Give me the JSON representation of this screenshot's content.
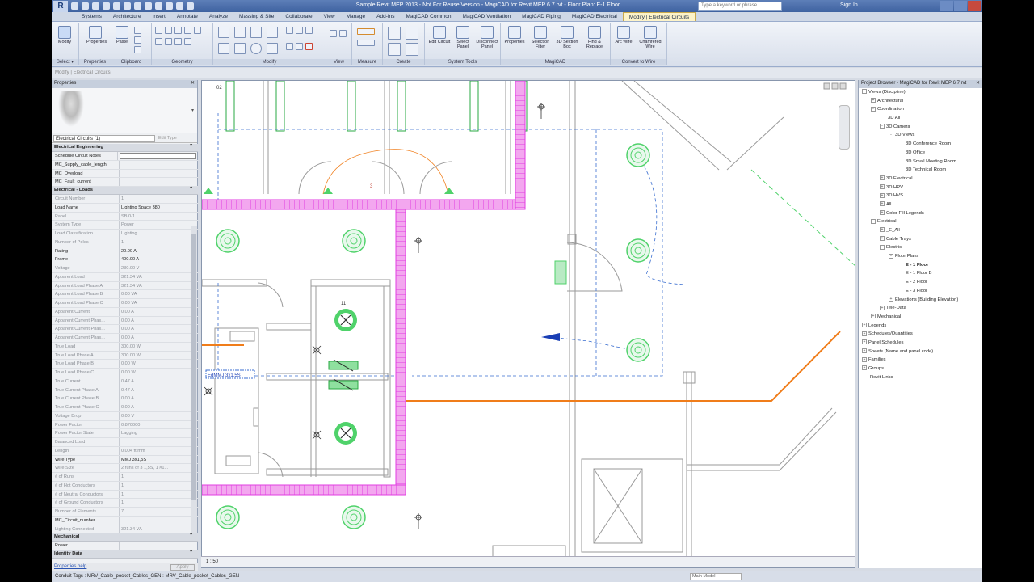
{
  "titlebar": {
    "title": "Sample Revit MEP 2013 - Not For Reuse Version - MagiCAD for Revit MEP 6.7.rvt - Floor Plan: E-1 Floor",
    "search_placeholder": "Type a keyword or phrase",
    "signin": "Sign In"
  },
  "tabs": [
    "Systems",
    "Architecture",
    "Insert",
    "Annotate",
    "Analyze",
    "Massing & Site",
    "Collaborate",
    "View",
    "Manage",
    "Add-Ins",
    "MagiCAD Common",
    "MagiCAD Ventilation",
    "MagiCAD Piping",
    "MagiCAD Electrical",
    "Modify | Electrical Circuits"
  ],
  "active_tab": "Modify | Electrical Circuits",
  "ribbon": {
    "groups": [
      "Select",
      "Properties",
      "Clipboard",
      "Geometry",
      "Modify",
      "View",
      "Measure",
      "Create",
      "System Tools",
      "MagiCAD",
      "Convert to Wire"
    ],
    "buttons": {
      "modify": "Modify",
      "properties": "Properties",
      "paste": "Paste",
      "cut": "Cut",
      "edit_circuit": "Edit Circuit",
      "select_panel": "Select Panel",
      "disconnect_panel": "Disconnect Panel",
      "mc_properties": "Properties",
      "selection_filter": "Selection Filter",
      "section_box": "3D Section Box",
      "find_replace": "Find & Replace",
      "arc_wire": "Arc Wire",
      "chamfered_wire": "Chamfered Wire"
    },
    "select_dd": "Select ▾"
  },
  "optionsbar": "Modify | Electrical Circuits",
  "properties": {
    "header": "Properties",
    "type_selector": "Electrical Circuits (1)",
    "edit_type": "Edit Type",
    "sections": [
      {
        "title": "Electrical Engineering",
        "rows": [
          {
            "k": "Schedule Circuit Notes",
            "v": "",
            "dim": false,
            "input": true
          },
          {
            "k": "MC_Supply_cable_length",
            "v": "",
            "dim": false
          },
          {
            "k": "MC_Overload",
            "v": "",
            "dim": false
          },
          {
            "k": "MC_Fault_current",
            "v": "",
            "dim": false
          }
        ]
      },
      {
        "title": "Electrical - Loads",
        "rows": [
          {
            "k": "Circuit Number",
            "v": "1",
            "dim": true
          },
          {
            "k": "Load Name",
            "v": "Lighting Space 380",
            "dim": false
          },
          {
            "k": "Panel",
            "v": "SB 0-1",
            "dim": true
          },
          {
            "k": "System Type",
            "v": "Power",
            "dim": true
          },
          {
            "k": "Load Classification",
            "v": "Lighting",
            "dim": true
          },
          {
            "k": "Number of Poles",
            "v": "1",
            "dim": true
          },
          {
            "k": "Rating",
            "v": "20.00 A",
            "dim": false
          },
          {
            "k": "Frame",
            "v": "400.00 A",
            "dim": false
          },
          {
            "k": "Voltage",
            "v": "230.00 V",
            "dim": true
          },
          {
            "k": "Apparent Load",
            "v": "321.34 VA",
            "dim": true
          },
          {
            "k": "Apparent Load Phase A",
            "v": "321.34 VA",
            "dim": true
          },
          {
            "k": "Apparent Load Phase B",
            "v": "0.00 VA",
            "dim": true
          },
          {
            "k": "Apparent Load Phase C",
            "v": "0.00 VA",
            "dim": true
          },
          {
            "k": "Apparent Current",
            "v": "0.00 A",
            "dim": true
          },
          {
            "k": "Apparent Current Phas...",
            "v": "0.00 A",
            "dim": true
          },
          {
            "k": "Apparent Current Phas...",
            "v": "0.00 A",
            "dim": true
          },
          {
            "k": "Apparent Current Phas...",
            "v": "0.00 A",
            "dim": true
          },
          {
            "k": "True Load",
            "v": "300.00 W",
            "dim": true
          },
          {
            "k": "True Load Phase A",
            "v": "300.00 W",
            "dim": true
          },
          {
            "k": "True Load Phase B",
            "v": "0.00 W",
            "dim": true
          },
          {
            "k": "True Load Phase C",
            "v": "0.00 W",
            "dim": true
          },
          {
            "k": "True Current",
            "v": "0.47 A",
            "dim": true
          },
          {
            "k": "True Current Phase A",
            "v": "0.47 A",
            "dim": true
          },
          {
            "k": "True Current Phase B",
            "v": "0.00 A",
            "dim": true
          },
          {
            "k": "True Current Phase C",
            "v": "0.00 A",
            "dim": true
          },
          {
            "k": "Voltage Drop",
            "v": "0.00 V",
            "dim": true
          },
          {
            "k": "Power Factor",
            "v": "0.870000",
            "dim": true
          },
          {
            "k": "Power Factor State",
            "v": "Lagging",
            "dim": true
          },
          {
            "k": "Balanced Load",
            "v": "",
            "dim": true
          },
          {
            "k": "Length",
            "v": "0.004 ft mm",
            "dim": true
          },
          {
            "k": "Wire Type",
            "v": "MMJ 3x1,5S",
            "dim": false
          },
          {
            "k": "Wire Size",
            "v": "2 runs of 3 1,5S, 1 #1...",
            "dim": true
          },
          {
            "k": "# of Runs",
            "v": "1",
            "dim": true
          },
          {
            "k": "# of Hot Conductors",
            "v": "1",
            "dim": true
          },
          {
            "k": "# of Neutral Conductors",
            "v": "1",
            "dim": true
          },
          {
            "k": "# of Ground Conductors",
            "v": "1",
            "dim": true
          },
          {
            "k": "Number of Elements",
            "v": "7",
            "dim": true
          },
          {
            "k": "MC_Circuit_number",
            "v": "",
            "dim": false
          },
          {
            "k": "Lighting Connected",
            "v": "321.34 VA",
            "dim": true
          }
        ]
      },
      {
        "title": "Mechanical",
        "rows": [
          {
            "k": "Power",
            "v": "",
            "dim": false
          }
        ]
      },
      {
        "title": "Identity Data",
        "rows": []
      }
    ],
    "help_link": "Properties help",
    "apply": "Apply"
  },
  "canvas": {
    "scale": "1 : 50",
    "wire_tag": "EdMMJ 3x1,5S",
    "labels": [
      "3",
      "11",
      "02"
    ],
    "colors": {
      "wall": "#e23ee0",
      "wire": "#f07d1a",
      "fixture": "#4fd26a",
      "dash": "#3a6ed0"
    }
  },
  "browser": {
    "header": "Project Browser - MagiCAD for Revit MEP 6.7.rvt",
    "items": [
      {
        "t": "Views (Discipline)",
        "l": 0,
        "tg": "-",
        "b": false
      },
      {
        "t": "Architectural",
        "l": 1,
        "tg": "+",
        "b": false
      },
      {
        "t": "Coordination",
        "l": 1,
        "tg": "-",
        "b": false
      },
      {
        "t": "3D All",
        "l": 2,
        "tg": "",
        "b": false
      },
      {
        "t": "3D Camera",
        "l": 2,
        "tg": "-",
        "b": false
      },
      {
        "t": "3D Views",
        "l": 3,
        "tg": "-",
        "b": false
      },
      {
        "t": "3D Conference Room",
        "l": 4,
        "tg": "",
        "b": false
      },
      {
        "t": "3D Office",
        "l": 4,
        "tg": "",
        "b": false
      },
      {
        "t": "3D Small Meeting Room",
        "l": 4,
        "tg": "",
        "b": false
      },
      {
        "t": "3D Technical Room",
        "l": 4,
        "tg": "",
        "b": false
      },
      {
        "t": "3D Electrical",
        "l": 2,
        "tg": "+",
        "b": false
      },
      {
        "t": "3D HPV",
        "l": 2,
        "tg": "+",
        "b": false
      },
      {
        "t": "3D HVS",
        "l": 2,
        "tg": "+",
        "b": false
      },
      {
        "t": "All",
        "l": 2,
        "tg": "+",
        "b": false
      },
      {
        "t": "Color Fill Legends",
        "l": 2,
        "tg": "+",
        "b": false
      },
      {
        "t": "Electrical",
        "l": 1,
        "tg": "-",
        "b": false
      },
      {
        "t": "_E_All",
        "l": 2,
        "tg": "+",
        "b": false
      },
      {
        "t": "Cable Trays",
        "l": 2,
        "tg": "+",
        "b": false
      },
      {
        "t": "Electric",
        "l": 2,
        "tg": "-",
        "b": false
      },
      {
        "t": "Floor Plans",
        "l": 3,
        "tg": "-",
        "b": false
      },
      {
        "t": "E - 1 Floor",
        "l": 4,
        "tg": "",
        "b": true
      },
      {
        "t": "E - 1 Floor B",
        "l": 4,
        "tg": "",
        "b": false
      },
      {
        "t": "E - 2 Floor",
        "l": 4,
        "tg": "",
        "b": false
      },
      {
        "t": "E - 3 Floor",
        "l": 4,
        "tg": "",
        "b": false
      },
      {
        "t": "Elevations (Building Elevation)",
        "l": 3,
        "tg": "+",
        "b": false
      },
      {
        "t": "Tele-Data",
        "l": 2,
        "tg": "+",
        "b": false
      },
      {
        "t": "Mechanical",
        "l": 1,
        "tg": "+",
        "b": false
      },
      {
        "t": "Legends",
        "l": 0,
        "tg": "+",
        "b": false
      },
      {
        "t": "Schedules/Quantities",
        "l": 0,
        "tg": "+",
        "b": false
      },
      {
        "t": "Panel Schedules",
        "l": 0,
        "tg": "+",
        "b": false
      },
      {
        "t": "Sheets (Name and panel code)",
        "l": 0,
        "tg": "+",
        "b": false
      },
      {
        "t": "Families",
        "l": 0,
        "tg": "+",
        "b": false
      },
      {
        "t": "Groups",
        "l": 0,
        "tg": "+",
        "b": false
      },
      {
        "t": "Revit Links",
        "l": 0,
        "tg": "",
        "b": false
      }
    ]
  },
  "status": {
    "text": "Conduit Tags : MRV_Cable_pocket_Cables_GEN : MRV_Cable_pocket_Cables_GEN",
    "model": "Main Model"
  }
}
